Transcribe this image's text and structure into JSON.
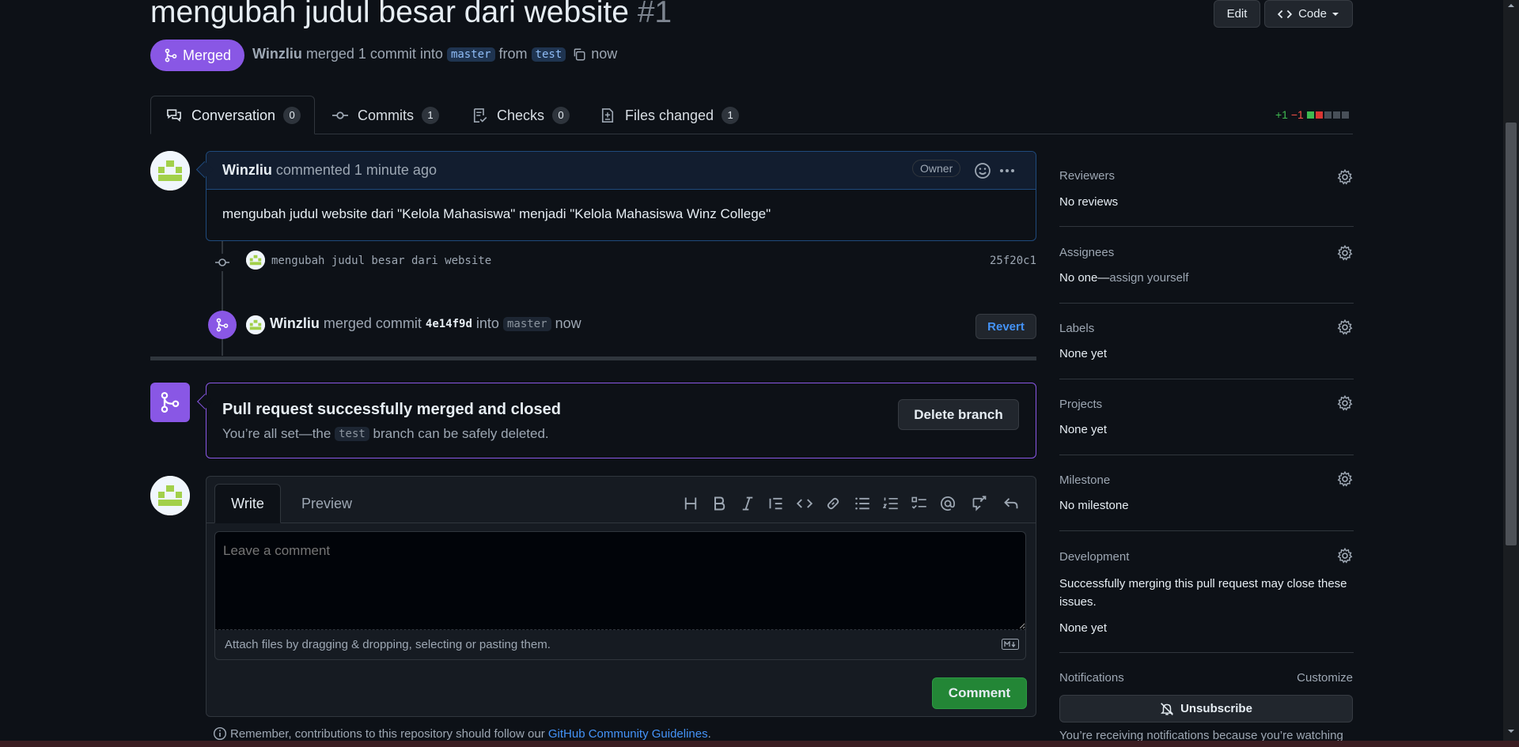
{
  "pr": {
    "title": "mengubah judul besar dari website",
    "number": "#1",
    "state_label": "Merged",
    "author": "Winzliu",
    "merge_text": "merged 1 commit into",
    "base_branch": "master",
    "from_word": "from",
    "head_branch": "test",
    "time": "now"
  },
  "header_buttons": {
    "edit_label": "Edit",
    "code_label": "Code"
  },
  "tabs": [
    {
      "label": "Conversation",
      "count": "0"
    },
    {
      "label": "Commits",
      "count": "1"
    },
    {
      "label": "Checks",
      "count": "0"
    },
    {
      "label": "Files changed",
      "count": "1"
    }
  ],
  "diffstat": {
    "additions": "+1",
    "deletions": "−1"
  },
  "comment": {
    "author": "Winzliu",
    "action": "commented 1 minute ago",
    "badge": "Owner",
    "body": "mengubah judul website dari \"Kelola Mahasiswa\" menjadi \"Kelola Mahasiswa Winz College\""
  },
  "commit_event": {
    "message": "mengubah judul besar dari website",
    "sha": "25f20c1"
  },
  "merge_event": {
    "author": "Winzliu",
    "action": "merged commit",
    "sha": "4e14f9d",
    "into_word": "into",
    "branch": "master",
    "time": "now",
    "revert_label": "Revert"
  },
  "merged_box": {
    "title": "Pull request successfully merged and closed",
    "desc_before": "You’re all set—the",
    "branch": "test",
    "desc_after": "branch can be safely deleted.",
    "delete_label": "Delete branch"
  },
  "editor": {
    "tab_write": "Write",
    "tab_preview": "Preview",
    "placeholder": "Leave a comment",
    "attach_hint": "Attach files by dragging & dropping, selecting or pasting them.",
    "comment_button": "Comment"
  },
  "footer_note": {
    "text": "Remember, contributions to this repository should follow our",
    "link": "GitHub Community Guidelines",
    "end": "."
  },
  "sidebar": {
    "reviewers": {
      "title": "Reviewers",
      "value": "No reviews"
    },
    "assignees": {
      "title": "Assignees",
      "value": "No one—",
      "link": "assign yourself"
    },
    "labels": {
      "title": "Labels",
      "value": "None yet"
    },
    "projects": {
      "title": "Projects",
      "value": "None yet"
    },
    "milestone": {
      "title": "Milestone",
      "value": "No milestone"
    },
    "development": {
      "title": "Development",
      "desc": "Successfully merging this pull request may close these issues.",
      "value": "None yet"
    },
    "notifications": {
      "title": "Notifications",
      "customize": "Customize",
      "unsubscribe_label": "Unsubscribe",
      "reason": "You’re receiving notifications because you’re watching"
    }
  },
  "colors": {
    "accent_purple": "#8957e5",
    "link_blue": "#4493f8",
    "comment_green": "#238636",
    "bg": "#0d1117"
  },
  "icons": [
    "merge-icon",
    "copy-icon",
    "code-icon",
    "chevron-down-icon",
    "conversation-icon",
    "commit-icon",
    "checklist-icon",
    "file-diff-icon",
    "smiley-icon",
    "kebab-icon",
    "gear-icon",
    "bell-slash-icon",
    "info-icon",
    "markdown-icon"
  ]
}
